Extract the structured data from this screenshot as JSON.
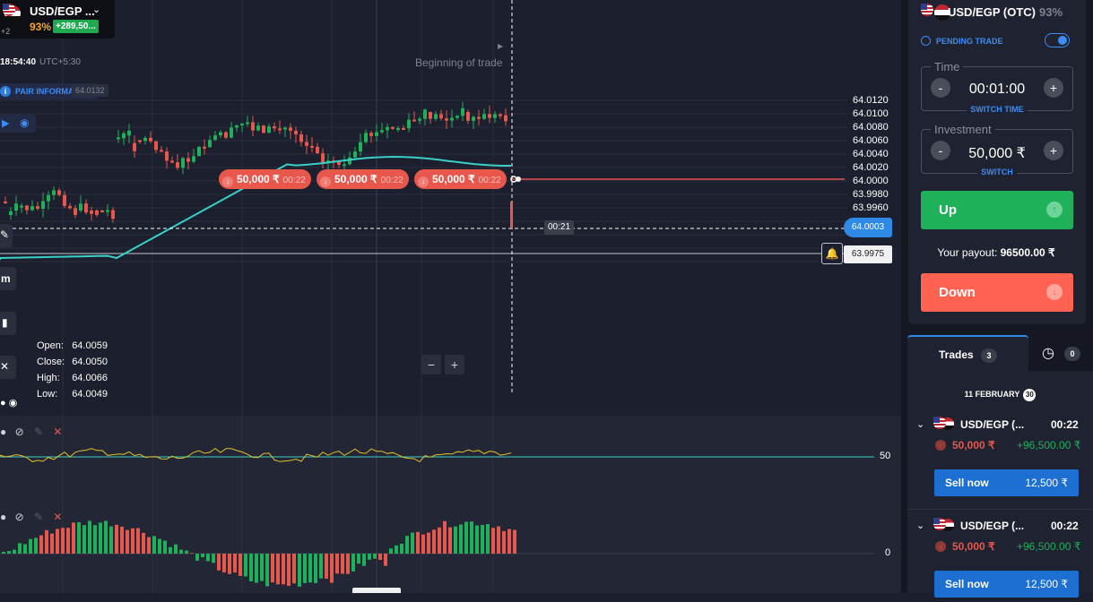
{
  "colors": {
    "accent": "#2f8ae5",
    "up": "#1fb15a",
    "down": "#e8574c",
    "background": "#1c1f2d",
    "panel": "#1f2230"
  },
  "header": {
    "asset_name": "USD/EGP ...",
    "payout_pct": "93%",
    "gain_badge": "+289,50...",
    "extra_count": "+2",
    "time": "18:54:40",
    "timezone": "UTC+5:30"
  },
  "pair_info": {
    "label": "PAIR INFORMATION",
    "price": "64.0132"
  },
  "chart": {
    "beginning_label": "Beginning of trade",
    "y_ticks": [
      "64.0120",
      "64.0100",
      "64.0080",
      "64.0060",
      "64.0040",
      "64.0020",
      "64.0000",
      "63.9980",
      "63.9960"
    ],
    "current_price": "64.0003",
    "alert_price": "63.9975",
    "countdown": "00:21",
    "trades": [
      {
        "amount": "50,000 ₹",
        "time": "00:22"
      },
      {
        "amount": "50,000 ₹",
        "time": "00:22"
      },
      {
        "amount": "50,000 ₹",
        "time": "00:22"
      }
    ],
    "left_tool_label": "m",
    "ohlc": [
      {
        "label": "Open:",
        "value": "64.0059"
      },
      {
        "label": "Close:",
        "value": "64.0050"
      },
      {
        "label": "High:",
        "value": "64.0066"
      },
      {
        "label": "Low:",
        "value": "64.0049"
      }
    ],
    "zoom_out": "−",
    "zoom_in": "+"
  },
  "indicators": {
    "rsi_level": "50",
    "macd_level": "0"
  },
  "sidebar": {
    "asset": "USD/EGP (OTC)",
    "payout": "93%",
    "pending_trade": "PENDING TRADE",
    "time_label": "Time",
    "time_value": "00:01:00",
    "switch_time": "SWITCH TIME",
    "investment_label": "Investment",
    "investment_value": "50,000 ₹",
    "switch": "SWITCH",
    "minus": "-",
    "plus": "+",
    "up_label": "Up",
    "down_label": "Down",
    "payout_label": "Your payout:",
    "payout_value": "96500.00 ₹"
  },
  "trades_panel": {
    "tab_trades": "Trades",
    "trades_count": "3",
    "history_count": "0",
    "date": "11 FEBRUARY",
    "date_count": "30",
    "items": [
      {
        "asset": "USD/EGP (...",
        "time": "00:22",
        "amount": "50,000 ₹",
        "payout": "+96,500.00 ₹",
        "sell_label": "Sell now",
        "sell_value": "12,500 ₹"
      },
      {
        "asset": "USD/EGP (...",
        "time": "00:22",
        "amount": "50,000 ₹",
        "payout": "+96,500.00 ₹",
        "sell_label": "Sell now",
        "sell_value": "12,500 ₹"
      }
    ]
  }
}
